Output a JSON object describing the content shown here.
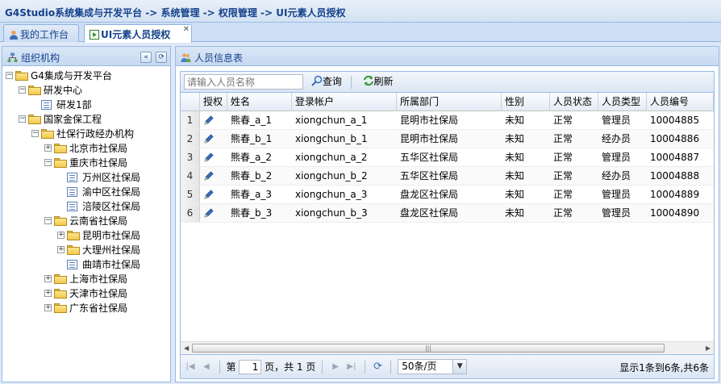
{
  "breadcrumb": "G4Studio系统集成与开发平台 -> 系统管理 -> 权限管理 -> UI元素人员授权",
  "tabs": [
    {
      "label": "我的工作台",
      "icon": "user-icon"
    },
    {
      "label": "UI元素人员授权",
      "icon": "play-icon",
      "close": "✕"
    }
  ],
  "left_panel": {
    "title": "组织机构",
    "tools": [
      "«",
      "⟳"
    ],
    "tree": [
      {
        "label": "G4集成与开发平台",
        "toggle": "−",
        "kind": "folder"
      },
      {
        "label": "研发中心",
        "toggle": "−",
        "kind": "folder"
      },
      {
        "label": "研发1部",
        "toggle": "",
        "kind": "leaf"
      },
      {
        "label": "国家金保工程",
        "toggle": "−",
        "kind": "folder"
      },
      {
        "label": "社保行政经办机构",
        "toggle": "−",
        "kind": "folder"
      },
      {
        "label": "北京市社保局",
        "toggle": "+",
        "kind": "folder"
      },
      {
        "label": "重庆市社保局",
        "toggle": "−",
        "kind": "folder"
      },
      {
        "label": "万州区社保局",
        "toggle": "",
        "kind": "leaf"
      },
      {
        "label": "渝中区社保局",
        "toggle": "",
        "kind": "leaf"
      },
      {
        "label": "涪陵区社保局",
        "toggle": "",
        "kind": "leaf"
      },
      {
        "label": "云南省社保局",
        "toggle": "−",
        "kind": "folder"
      },
      {
        "label": "昆明市社保局",
        "toggle": "+",
        "kind": "folder"
      },
      {
        "label": "大理州社保局",
        "toggle": "+",
        "kind": "folder"
      },
      {
        "label": "曲靖市社保局",
        "toggle": "",
        "kind": "leaf"
      },
      {
        "label": "上海市社保局",
        "toggle": "+",
        "kind": "folder"
      },
      {
        "label": "天津市社保局",
        "toggle": "+",
        "kind": "folder"
      },
      {
        "label": "广东省社保局",
        "toggle": "+",
        "kind": "folder"
      }
    ]
  },
  "right_panel": {
    "title": "人员信息表",
    "search_placeholder": "请输入人员名称",
    "query_label": "查询",
    "refresh_label": "刷新",
    "columns": [
      "授权",
      "姓名",
      "登录帐户",
      "所属部门",
      "性别",
      "人员状态",
      "人员类型",
      "人员编号"
    ],
    "rows": [
      {
        "num": "1",
        "name": "熊春_a_1",
        "account": "xiongchun_a_1",
        "dept": "昆明市社保局",
        "gender": "未知",
        "status": "正常",
        "type": "管理员",
        "code": "10004885"
      },
      {
        "num": "2",
        "name": "熊春_b_1",
        "account": "xiongchun_b_1",
        "dept": "昆明市社保局",
        "gender": "未知",
        "status": "正常",
        "type": "经办员",
        "code": "10004886"
      },
      {
        "num": "3",
        "name": "熊春_a_2",
        "account": "xiongchun_a_2",
        "dept": "五华区社保局",
        "gender": "未知",
        "status": "正常",
        "type": "管理员",
        "code": "10004887"
      },
      {
        "num": "4",
        "name": "熊春_b_2",
        "account": "xiongchun_b_2",
        "dept": "五华区社保局",
        "gender": "未知",
        "status": "正常",
        "type": "经办员",
        "code": "10004888"
      },
      {
        "num": "5",
        "name": "熊春_a_3",
        "account": "xiongchun_a_3",
        "dept": "盘龙区社保局",
        "gender": "未知",
        "status": "正常",
        "type": "管理员",
        "code": "10004889"
      },
      {
        "num": "6",
        "name": "熊春_b_3",
        "account": "xiongchun_b_3",
        "dept": "盘龙区社保局",
        "gender": "未知",
        "status": "正常",
        "type": "管理员",
        "code": "10004890"
      }
    ],
    "pager": {
      "page_prefix": "第",
      "page_value": "1",
      "page_suffix": "页，共 1 页",
      "page_size": "50条/页",
      "info": "显示1条到6条,共6条"
    }
  }
}
